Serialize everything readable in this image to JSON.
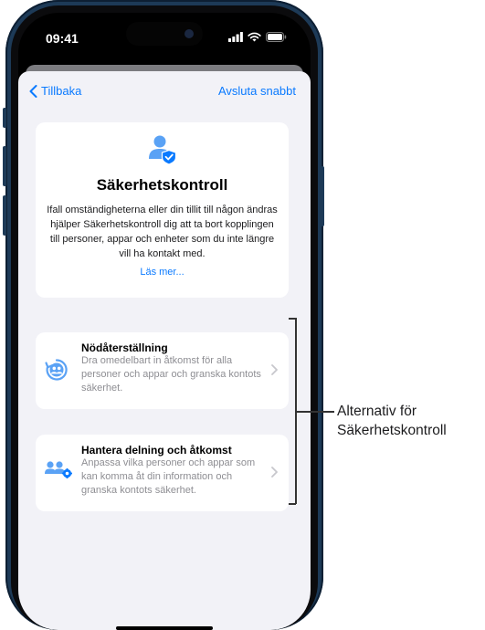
{
  "status_bar": {
    "time": "09:41"
  },
  "nav": {
    "back_label": "Tillbaka",
    "quick_exit_label": "Avsluta snabbt"
  },
  "intro": {
    "title": "Säkerhetskontroll",
    "description": "Ifall omständigheterna eller din tillit till någon ändras hjälper Säkerhetskontroll dig att ta bort kopplingen till personer, appar och enheter som du inte längre vill ha kontakt med.",
    "read_more": "Läs mer..."
  },
  "options": [
    {
      "title": "Nödåterställning",
      "description": "Dra omedelbart in åtkomst för alla personer och appar och granska kontots säkerhet.",
      "icon": "emergency-reset-icon"
    },
    {
      "title": "Hantera delning och åtkomst",
      "description": "Anpassa vilka personer och appar som kan komma åt din information och granska kontots säkerhet.",
      "icon": "manage-sharing-icon"
    }
  ],
  "callout": {
    "line1": "Alternativ för",
    "line2": "Säkerhetskontroll"
  },
  "colors": {
    "accent": "#0a7aff",
    "frame": "#1d3a57",
    "background": "#f2f2f7",
    "icon_blue": "#5aa2f5"
  }
}
